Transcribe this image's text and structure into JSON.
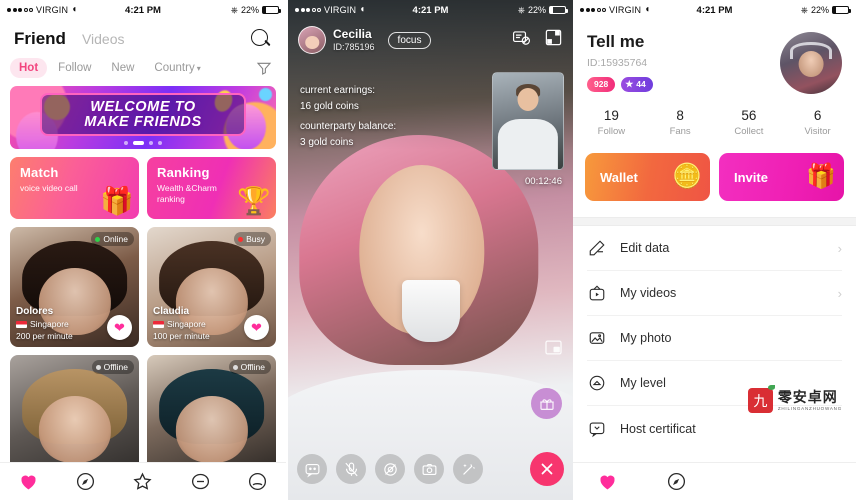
{
  "statusbar": {
    "carrier": "VIRGIN",
    "time": "4:21 PM",
    "battery_pct": "22%",
    "wifi_icon": "wifi-icon",
    "bluetooth_icon": "bluetooth-icon"
  },
  "panel1": {
    "header": {
      "title": "Friend",
      "secondary": "Videos",
      "search_icon": "search-icon"
    },
    "tabs": [
      {
        "label": "Hot",
        "active": true
      },
      {
        "label": "Follow",
        "active": false
      },
      {
        "label": "New",
        "active": false
      },
      {
        "label": "Country",
        "active": false,
        "caret": "▾"
      }
    ],
    "filter_icon": "filter-icon",
    "banner": {
      "line1": "WELCOME TO",
      "line2": "MAKE FRIENDS"
    },
    "promos": [
      {
        "title": "Match",
        "sub": "voice video call",
        "art": "🎁"
      },
      {
        "title": "Ranking",
        "sub": "Wealth &Charm ranking",
        "art": "🏆"
      }
    ],
    "users": [
      {
        "name": "Dolores",
        "country": "Singapore",
        "rate": "200 per minute",
        "status": "Online"
      },
      {
        "name": "Claudia",
        "country": "Singapore",
        "rate": "100 per minute",
        "status": "Busy"
      },
      {
        "name": "",
        "country": "",
        "rate": "",
        "status": "Offline"
      },
      {
        "name": "",
        "country": "",
        "rate": "",
        "status": "Offline"
      }
    ],
    "tabbar": [
      "heart-icon",
      "compass-icon",
      "star-icon",
      "message-icon",
      "profile-icon"
    ]
  },
  "panel2": {
    "caller": {
      "name": "Cecilia",
      "id": "ID:785196",
      "focus_label": "focus"
    },
    "head_icons": [
      "block-list-icon",
      "minimize-icon"
    ],
    "earnings": {
      "label1": "current earnings:",
      "value1": "16 gold coins",
      "label2": "counterparty balance:",
      "value2": "3 gold coins"
    },
    "timer": "00:12:46",
    "pip_icon": "picture-in-picture-icon",
    "gift_icon": "gift-icon",
    "controls": [
      "chat-icon",
      "mute-icon",
      "camera-off-icon",
      "switch-camera-icon",
      "effects-icon"
    ],
    "end_call_icon": "end-call-icon"
  },
  "panel3": {
    "title": "Tell me",
    "id": "ID:15935764",
    "badges": [
      {
        "text": "928"
      },
      {
        "text": "44",
        "star": "★"
      }
    ],
    "stats": [
      {
        "value": "19",
        "label": "Follow"
      },
      {
        "value": "8",
        "label": "Fans"
      },
      {
        "value": "56",
        "label": "Collect"
      },
      {
        "value": "6",
        "label": "Visitor"
      }
    ],
    "actions": [
      {
        "label": "Wallet",
        "art": "🪙"
      },
      {
        "label": "Invite",
        "art": "🎁"
      }
    ],
    "menu": [
      {
        "label": "Edit data",
        "icon": "pencil-icon",
        "chevron": "›"
      },
      {
        "label": "My videos",
        "icon": "video-icon",
        "chevron": "›"
      },
      {
        "label": "My photo",
        "icon": "photo-icon",
        "chevron": ""
      },
      {
        "label": "My level",
        "icon": "level-icon",
        "chevron": ""
      },
      {
        "label": "Host certificat",
        "icon": "certificate-icon",
        "chevron": ""
      }
    ],
    "watermark": {
      "seal": "九",
      "cn": "零安卓网",
      "en": "ZHILINGANZHUOWANG"
    },
    "tabbar": [
      "heart-icon",
      "compass-icon"
    ]
  }
}
